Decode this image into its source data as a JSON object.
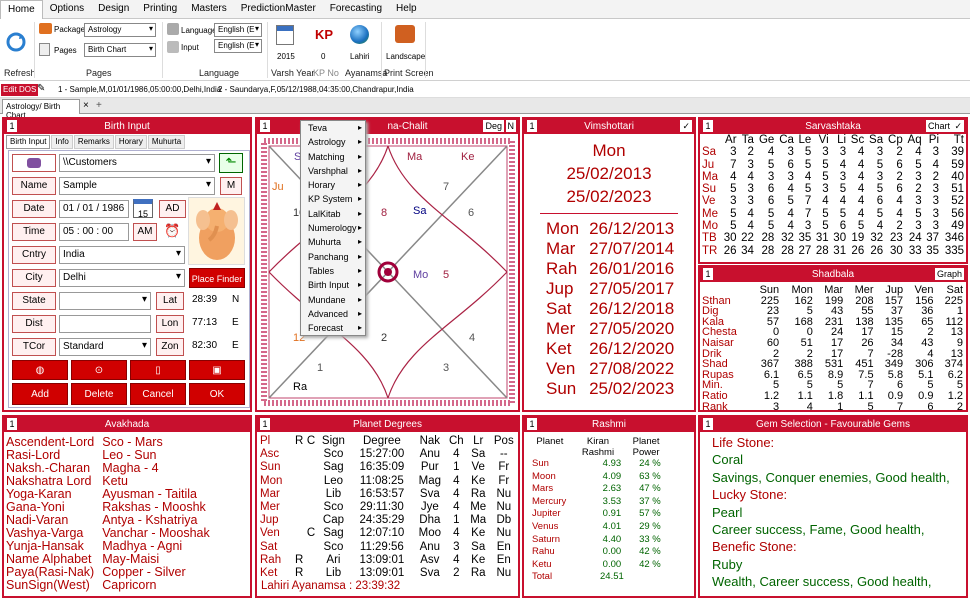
{
  "menu": [
    "Home",
    "Options",
    "Design",
    "Printing",
    "Masters",
    "PredictionMaster",
    "Forecasting",
    "Help"
  ],
  "ribbon": {
    "refresh": "Refresh",
    "package_lbl": "Package",
    "package_val": "Astrology",
    "pages_lbl": "Pages",
    "pages_val": "Birth Chart",
    "pages_group": "Pages",
    "language_lbl": "Language",
    "language_val": "English (E",
    "input_lbl": "Input",
    "input_val": "English (E",
    "language_group": "Language",
    "varsh_val": "2015",
    "varsh_lbl": "Varsh Year",
    "kp": "KP",
    "kp_no": "0",
    "kp_no_lbl": "KP No",
    "lahiri": "Lahiri",
    "ayanamsa_lbl": "Ayanamsa",
    "landscape": "Landscape",
    "print_lbl": "Print Screen"
  },
  "dos": {
    "edit": "Edit DOS",
    "rec1": "1 - Sample,M,01/01/1986,05:00:00,Delhi,India",
    "rec2": "2 - Saundarya,F,05/12/1988,04:35:00,Chandrapur,India"
  },
  "tab": {
    "label": "Astrology/ Birth Chart",
    "close": "×",
    "add": "+"
  },
  "birth": {
    "title": "Birth Input",
    "num": "1",
    "tabs": [
      "Birth Input",
      "Info",
      "Remarks",
      "Horary",
      "Muhurta"
    ],
    "customers": "\\\\Customers",
    "name_lbl": "Name",
    "name_val": "Sample",
    "m_btn": "M",
    "date_lbl": "Date",
    "date_val": "01 / 01 /  1986",
    "cal": "15",
    "ad": "AD",
    "time_lbl": "Time",
    "time_val": "05 :  00  :  00",
    "am": "AM",
    "cntry_lbl": "Cntry",
    "cntry_val": "India",
    "city_lbl": "City",
    "city_val": "Delhi",
    "place_finder": "Place Finder",
    "state_lbl": "State",
    "lat_lbl": "Lat",
    "lat_val": "28:39",
    "lat_dir": "N",
    "dist_lbl": "Dist",
    "lon_lbl": "Lon",
    "lon_val": "77:13",
    "lon_dir": "E",
    "tcor_lbl": "TCor",
    "tcor_val": "Standard",
    "zon_lbl": "Zon",
    "zon_val": "82:30",
    "zon_dir": "E",
    "add": "Add",
    "delete": "Delete",
    "cancel": "Cancel",
    "ok": "OK"
  },
  "chart": {
    "num": "1",
    "title": "Bhava-Chalit",
    "title_visible": "na-Chalit",
    "deg": "Deg",
    "n": "N",
    "signs": [
      "8",
      "7",
      "6",
      "5",
      "4",
      "3",
      "2",
      "1",
      "12",
      "10"
    ],
    "planets": [
      "Ma",
      "Ke",
      "Sa",
      "Mo",
      "Ra",
      "Ju",
      "S"
    ]
  },
  "context_menu": [
    "Teva",
    "Astrology",
    "Matching",
    "Varshphal",
    "Horary",
    "KP System",
    "LalKitab",
    "Numerology",
    "Muhurta",
    "Panchang",
    "Tables",
    "Birth Input",
    "Mundane",
    "Advanced",
    "Forecast"
  ],
  "vim": {
    "num": "1",
    "title": "Vimshottari",
    "check": "✓",
    "day": "Mon",
    "d1": "25/02/2013",
    "d2": "25/02/2023",
    "rows": [
      [
        "Mon",
        "26/12/2013"
      ],
      [
        "Mar",
        "27/07/2014"
      ],
      [
        "Rah",
        "26/01/2016"
      ],
      [
        "Jup",
        "27/05/2017"
      ],
      [
        "Sat",
        "26/12/2018"
      ],
      [
        "Mer",
        "27/05/2020"
      ],
      [
        "Ket",
        "26/12/2020"
      ],
      [
        "Ven",
        "27/08/2022"
      ],
      [
        "Sun",
        "25/02/2023"
      ]
    ]
  },
  "sarva": {
    "num": "1",
    "title": "Sarvashtaka",
    "chart_btn": "Chart",
    "check": "✓",
    "cols": [
      "",
      "Ar",
      "Ta",
      "Ge",
      "Ca",
      "Le",
      "Vi",
      "Li",
      "Sc",
      "Sa",
      "Cp",
      "Aq",
      "Pi",
      "Tt"
    ],
    "rows": [
      [
        "Sa",
        "3",
        "2",
        "4",
        "3",
        "5",
        "3",
        "3",
        "4",
        "3",
        "2",
        "4",
        "3",
        "39"
      ],
      [
        "Ju",
        "7",
        "3",
        "5",
        "6",
        "5",
        "5",
        "4",
        "4",
        "5",
        "6",
        "5",
        "4",
        "59"
      ],
      [
        "Ma",
        "4",
        "4",
        "3",
        "3",
        "4",
        "5",
        "3",
        "4",
        "3",
        "2",
        "3",
        "2",
        "40"
      ],
      [
        "Su",
        "5",
        "3",
        "6",
        "4",
        "5",
        "3",
        "5",
        "4",
        "5",
        "6",
        "2",
        "3",
        "51"
      ],
      [
        "Ve",
        "3",
        "3",
        "6",
        "5",
        "7",
        "4",
        "4",
        "4",
        "6",
        "4",
        "3",
        "3",
        "52"
      ],
      [
        "Me",
        "5",
        "4",
        "5",
        "4",
        "7",
        "5",
        "5",
        "4",
        "5",
        "4",
        "5",
        "3",
        "56"
      ],
      [
        "Mo",
        "5",
        "4",
        "5",
        "4",
        "3",
        "5",
        "6",
        "5",
        "4",
        "2",
        "3",
        "3",
        "49"
      ],
      [
        "TB",
        "30",
        "22",
        "28",
        "32",
        "35",
        "31",
        "30",
        "19",
        "32",
        "23",
        "24",
        "37",
        "346"
      ],
      [
        "TR",
        "26",
        "34",
        "28",
        "28",
        "27",
        "28",
        "31",
        "26",
        "26",
        "30",
        "33",
        "35",
        "335"
      ]
    ]
  },
  "shad": {
    "num": "1",
    "title": "Shadbala",
    "graph_btn": "Graph",
    "cols": [
      "",
      "Sun",
      "Mon",
      "Mar",
      "Mer",
      "Jup",
      "Ven",
      "Sat"
    ],
    "rows": [
      [
        "Sthan",
        "225",
        "162",
        "199",
        "208",
        "157",
        "156",
        "225"
      ],
      [
        "Dig",
        "23",
        "5",
        "43",
        "55",
        "37",
        "36",
        "1"
      ],
      [
        "Kala",
        "57",
        "168",
        "231",
        "138",
        "135",
        "65",
        "112"
      ],
      [
        "Chesta",
        "0",
        "0",
        "24",
        "17",
        "15",
        "2",
        "13"
      ],
      [
        "Naisar",
        "60",
        "51",
        "17",
        "26",
        "34",
        "43",
        "9"
      ],
      [
        "Drik",
        "2",
        "2",
        "17",
        "7",
        "-28",
        "4",
        "13"
      ],
      [
        "Shad",
        "367",
        "388",
        "531",
        "451",
        "349",
        "306",
        "374"
      ],
      [
        "Rupas",
        "6.1",
        "6.5",
        "8.9",
        "7.5",
        "5.8",
        "5.1",
        "6.2"
      ],
      [
        "Min.",
        "5",
        "5",
        "5",
        "7",
        "6",
        "5",
        "5"
      ],
      [
        "Ratio",
        "1.2",
        "1.1",
        "1.8",
        "1.1",
        "0.9",
        "0.9",
        "1.2"
      ],
      [
        "Rank",
        "3",
        "4",
        "1",
        "5",
        "7",
        "6",
        "2"
      ]
    ]
  },
  "avak": {
    "num": "1",
    "title": "Avakhada",
    "rows": [
      [
        "Ascendent-Lord",
        "Sco - Mars"
      ],
      [
        "Rasi-Lord",
        "Leo - Sun"
      ],
      [
        "Naksh.-Charan",
        "Magha - 4"
      ],
      [
        "Nakshatra Lord",
        "Ketu"
      ],
      [
        "Yoga-Karan",
        "Ayusman - Taitila"
      ],
      [
        "Gana-Yoni",
        "Rakshas - Mooshk"
      ],
      [
        "Nadi-Varan",
        "Antya - Kshatriya"
      ],
      [
        "Vashya-Varga",
        "Vanchar - Mooshak"
      ],
      [
        "Yunja-Hansak",
        "Madhya - Agni"
      ],
      [
        "Name Alphabet",
        "May-Maisi"
      ],
      [
        "Paya(Rasi-Nak)",
        "Copper - Silver"
      ],
      [
        "SunSign(West)",
        "Capricorn"
      ]
    ]
  },
  "pdeg": {
    "num": "1",
    "title": "Planet Degrees",
    "cols": [
      "Pl",
      "R",
      "C",
      "Sign",
      "Degree",
      "Nak",
      "Ch",
      "Lr",
      "Pos"
    ],
    "rows": [
      [
        "Asc",
        "",
        "",
        "Sco",
        "15:27:00",
        "Anu",
        "4",
        "Sa",
        "--"
      ],
      [
        "Sun",
        "",
        "",
        "Sag",
        "16:35:09",
        "Pur",
        "1",
        "Ve",
        "Fr"
      ],
      [
        "Mon",
        "",
        "",
        "Leo",
        "11:08:25",
        "Mag",
        "4",
        "Ke",
        "Fr"
      ],
      [
        "Mar",
        "",
        "",
        "Lib",
        "16:53:57",
        "Sva",
        "4",
        "Ra",
        "Nu"
      ],
      [
        "Mer",
        "",
        "",
        "Sco",
        "29:11:30",
        "Jye",
        "4",
        "Me",
        "Nu"
      ],
      [
        "Jup",
        "",
        "",
        "Cap",
        "24:35:29",
        "Dha",
        "1",
        "Ma",
        "Db"
      ],
      [
        "Ven",
        "",
        "C",
        "Sag",
        "12:07:10",
        "Moo",
        "4",
        "Ke",
        "Nu"
      ],
      [
        "Sat",
        "",
        "",
        "Sco",
        "11:29:56",
        "Anu",
        "3",
        "Sa",
        "En"
      ],
      [
        "Rah",
        "R",
        "",
        "Ari",
        "13:09:01",
        "Asv",
        "4",
        "Ke",
        "En"
      ],
      [
        "Ket",
        "R",
        "",
        "Lib",
        "13:09:01",
        "Sva",
        "2",
        "Ra",
        "Nu"
      ]
    ],
    "ayan": "Lahiri Ayanamsa : 23:39:32"
  },
  "rashmi": {
    "num": "1",
    "title": "Rashmi",
    "h1": "Planet",
    "h2": "Kiran",
    "h3": "Planet",
    "h2b": "Rashmi",
    "h3b": "Power",
    "rows": [
      [
        "Sun",
        "4.93",
        "24 %"
      ],
      [
        "Moon",
        "4.09",
        "63 %"
      ],
      [
        "Mars",
        "2.63",
        "47 %"
      ],
      [
        "Mercury",
        "3.53",
        "37 %"
      ],
      [
        "Jupiter",
        "0.91",
        "57 %"
      ],
      [
        "Venus",
        "4.01",
        "29 %"
      ],
      [
        "Saturn",
        "4.40",
        "33 %"
      ],
      [
        "Rahu",
        "0.00",
        "42 %"
      ],
      [
        "Ketu",
        "0.00",
        "42 %"
      ],
      [
        "Total",
        "24.51",
        ""
      ]
    ]
  },
  "gem": {
    "num": "1",
    "title": "Gem Selection - Favourable Gems",
    "l1": "Life Stone:",
    "v1": "Coral",
    "d1": "Savings, Conquer enemies, Good health,",
    "l2": "Lucky Stone:",
    "v2": "Pearl",
    "d2": "Career success, Fame, Good health,",
    "l3": "Benefic Stone:",
    "v3": "Ruby",
    "d3": "Wealth, Career success, Good health,"
  }
}
